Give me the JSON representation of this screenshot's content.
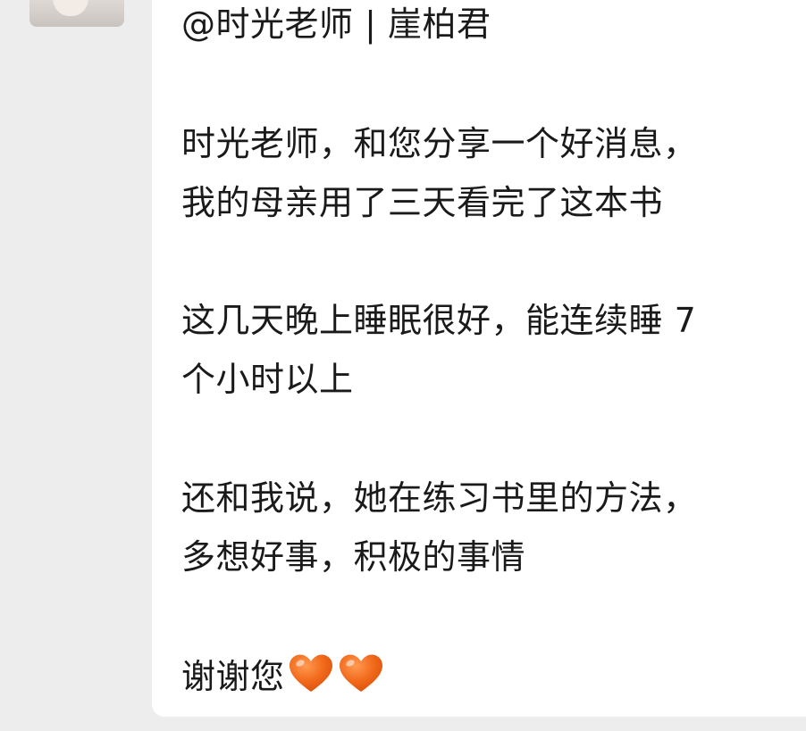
{
  "message": {
    "mention": "@时光老师 | 崖柏君",
    "para1": [
      "时光老师，和您分享一个好消息，",
      "我的母亲用了三天看完了这本书"
    ],
    "para2": [
      "这几天晚上睡眠很好，能连续睡 7",
      "个小时以上"
    ],
    "para3": [
      "还和我说，她在练习书里的方法，",
      "多想好事，积极的事情"
    ],
    "closing": "谢谢您",
    "closing_emojis": [
      "orange-heart-icon",
      "orange-heart-icon"
    ]
  },
  "colors": {
    "background": "#ededed",
    "bubble": "#ffffff",
    "text": "#1a1a1a",
    "heart": "#f26a1b"
  }
}
